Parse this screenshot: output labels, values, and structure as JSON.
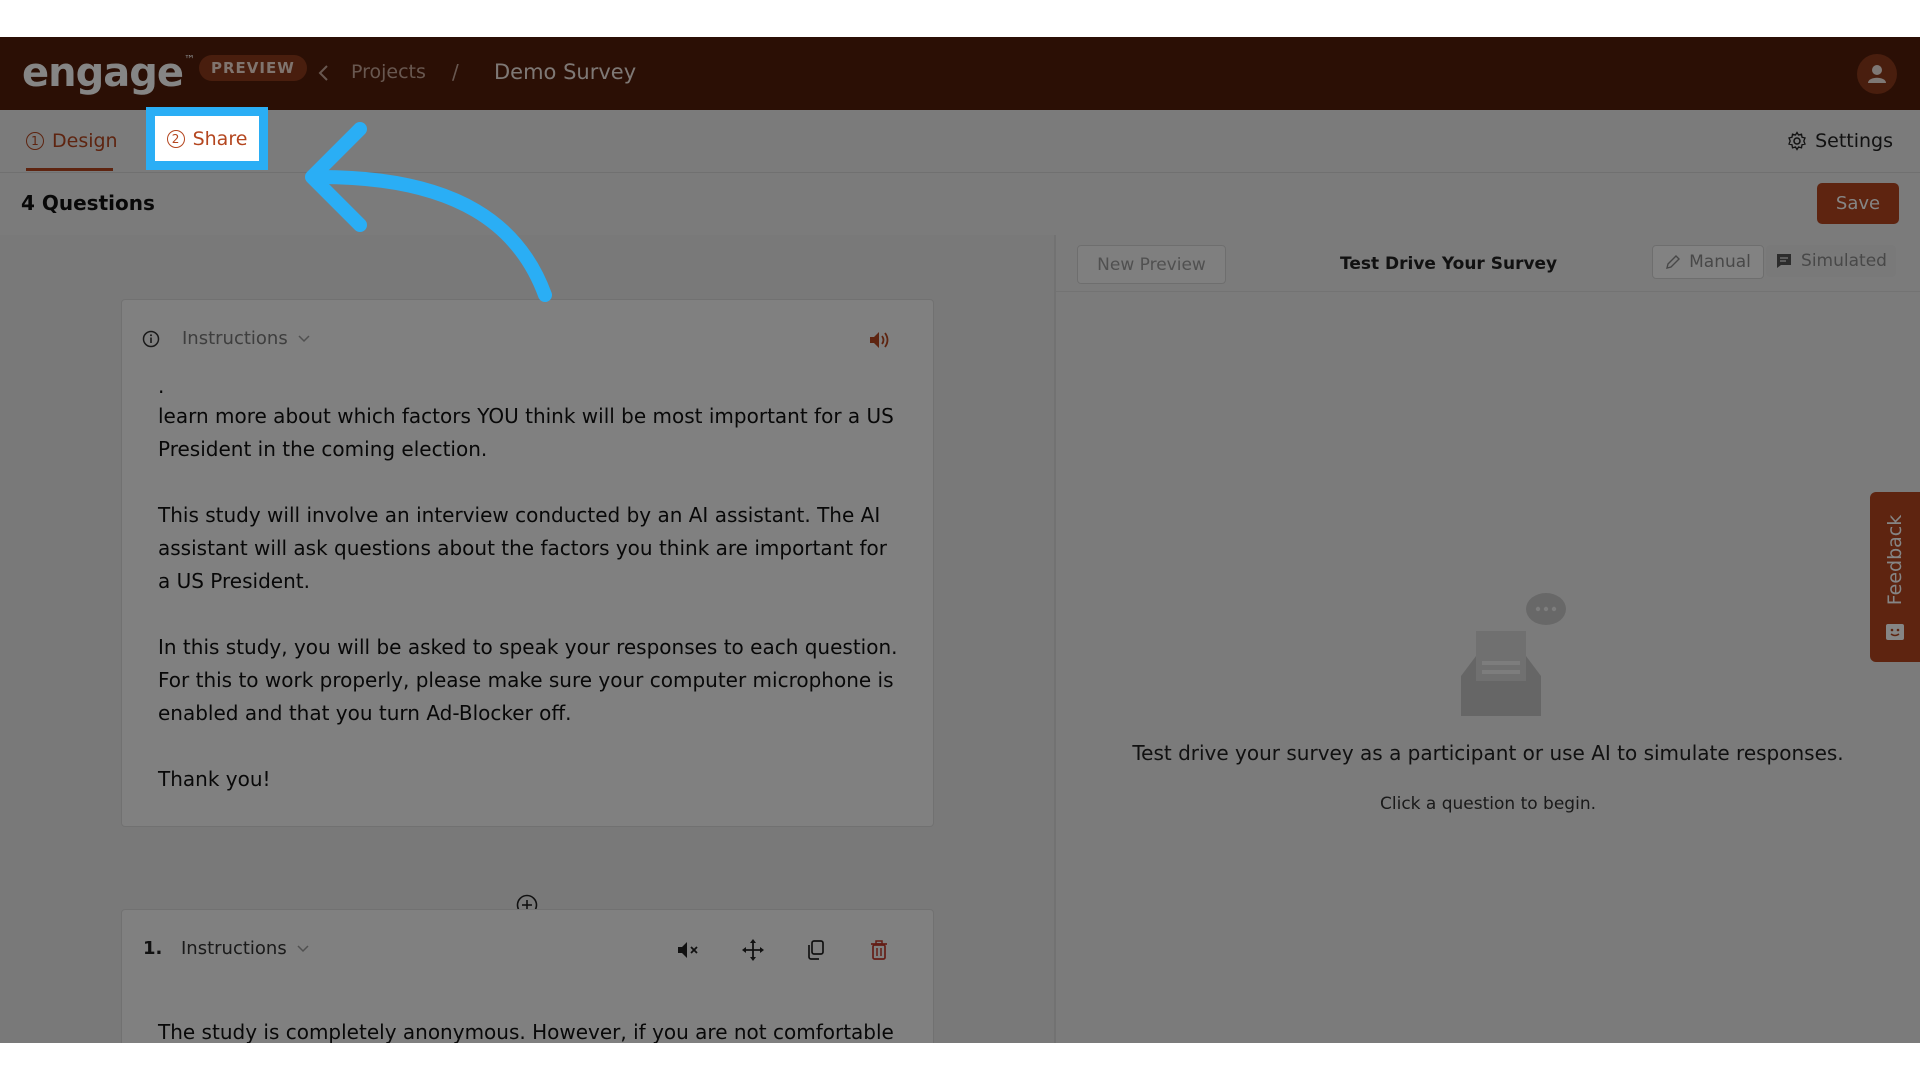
{
  "app": {
    "logo": "engage",
    "logo_tm": "™",
    "badge": "PREVIEW"
  },
  "breadcrumb": {
    "projects": "Projects",
    "separator": "/",
    "current": "Demo Survey"
  },
  "tabs": [
    {
      "number": "1",
      "label": "Design"
    },
    {
      "number": "2",
      "label": "Share"
    }
  ],
  "settings_label": "Settings",
  "questions_count": "4 Questions",
  "save_label": "Save",
  "cards": [
    {
      "type": "Instructions",
      "leading_dot": ".",
      "paragraphs": [
        "learn more about which factors YOU think will be most important for a US President in the coming election.",
        "This study will involve an interview conducted by an AI assistant. The AI assistant will ask questions about the factors you think are important for a US President.",
        "In this study, you will be asked to speak your responses to each question. For this to work properly, please make sure your computer microphone is enabled and that you turn Ad-Blocker off.",
        "Thank you!"
      ]
    },
    {
      "number": "1.",
      "type": "Instructions",
      "text": "The study is completely anonymous. However, if you are not comfortable"
    }
  ],
  "preview": {
    "new_preview": "New Preview",
    "title": "Test Drive Your Survey",
    "mode_manual": "Manual",
    "mode_simulated": "Simulated",
    "empty_main": "Test drive your survey as a participant or use AI to simulate responses.",
    "empty_sub": "Click a question to begin."
  },
  "feedback_label": "Feedback",
  "colors": {
    "brand_dark": "#541e0b",
    "accent": "#b4461f",
    "highlight": "#2aaef5"
  }
}
